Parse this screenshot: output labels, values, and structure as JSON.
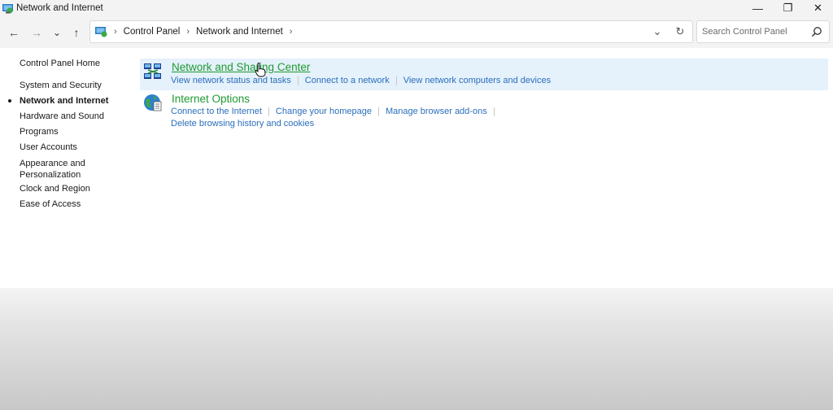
{
  "window": {
    "title": "Network and Internet",
    "controls": {
      "minimize": "—",
      "restore": "❐",
      "close": "✕"
    }
  },
  "navigation": {
    "back": "←",
    "forward": "→",
    "recent": "⌄",
    "up": "↑"
  },
  "address": {
    "breadcrumbs": [
      "Control Panel",
      "Network and Internet"
    ],
    "separator": "›",
    "dropdown": "⌄",
    "refresh": "↻"
  },
  "search": {
    "placeholder": "Search Control Panel",
    "value": ""
  },
  "sidebar": {
    "items": [
      {
        "label": "Control Panel Home",
        "active": false
      },
      {
        "label": "System and Security",
        "active": false
      },
      {
        "label": "Network and Internet",
        "active": true
      },
      {
        "label": "Hardware and Sound",
        "active": false
      },
      {
        "label": "Programs",
        "active": false
      },
      {
        "label": "User Accounts",
        "active": false
      },
      {
        "label": "Appearance and Personalization",
        "active": false
      },
      {
        "label": "Clock and Region",
        "active": false
      },
      {
        "label": "Ease of Access",
        "active": false
      }
    ]
  },
  "categories": [
    {
      "title": "Network and Sharing Center",
      "icon": "network-sharing-icon",
      "tasks": [
        "View network status and tasks",
        "Connect to a network",
        "View network computers and devices"
      ]
    },
    {
      "title": "Internet Options",
      "icon": "internet-options-icon",
      "tasks": [
        "Connect to the Internet",
        "Change your homepage",
        "Manage browser add-ons",
        "Delete browsing history and cookies"
      ]
    }
  ],
  "colors": {
    "category_title": "#1f9a32",
    "task_link": "#2a6ebb",
    "highlight": "#e5f1fb"
  }
}
